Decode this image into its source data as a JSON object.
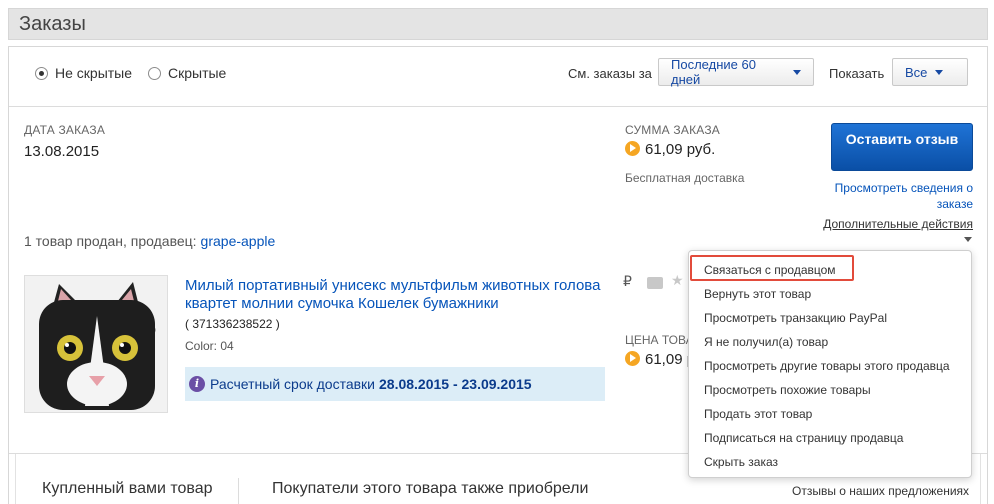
{
  "header": {
    "title": "Заказы"
  },
  "filters": {
    "radio_visible": "Не скрытые",
    "radio_hidden": "Скрытые",
    "selected": "visible",
    "period_label": "См. заказы за",
    "period_value": "Последние 60 дней",
    "show_label": "Показать",
    "show_value": "Все"
  },
  "order": {
    "date_label": "ДАТА ЗАКАЗА",
    "date": "13.08.2015",
    "sum_label": "СУММА ЗАКАЗА",
    "sum": "61,09 руб.",
    "shipping": "Бесплатная доставка",
    "leave_feedback": "Оставить отзыв",
    "view_details": "Просмотреть сведения о заказе",
    "more_actions": "Дополнительные действия",
    "seller_prefix": "1 товар продан, продавец:",
    "seller_name": "grape-apple"
  },
  "item": {
    "title": "Милый портативный унисекс мультфильм животных голова квартет молнии сумочка Кошелек бумажники",
    "number": "( 371336238522 )",
    "color": "Color: 04",
    "delivery_prefix": "Расчетный срок доставки",
    "delivery_range": "28.08.2015 - 23.09.2015",
    "currency_symbol": "₽",
    "price_label": "ЦЕНА ТОВА",
    "price": "61,09 р"
  },
  "menu": {
    "items": [
      "Связаться с продавцом",
      "Вернуть этот товар",
      "Просмотреть транзакцию PayPal",
      "Я не получил(а) товар",
      "Просмотреть другие товары этого продавца",
      "Просмотреть похожие товары",
      "Продать этот товар",
      "Подписаться на страницу продавца",
      "Скрыть заказ"
    ],
    "highlighted_index": 0
  },
  "bottom": {
    "tab_bought": "Купленный вами товар",
    "tab_also": "Покупатели этого товара также приобрели",
    "feedback": "Отзывы о наших предложениях"
  },
  "colors": {
    "link": "#0654ba",
    "primary_button": "#0a4fa6",
    "highlight": "#e24b3b",
    "coin": "#f5a623",
    "ship_bg": "#dcedf7"
  }
}
